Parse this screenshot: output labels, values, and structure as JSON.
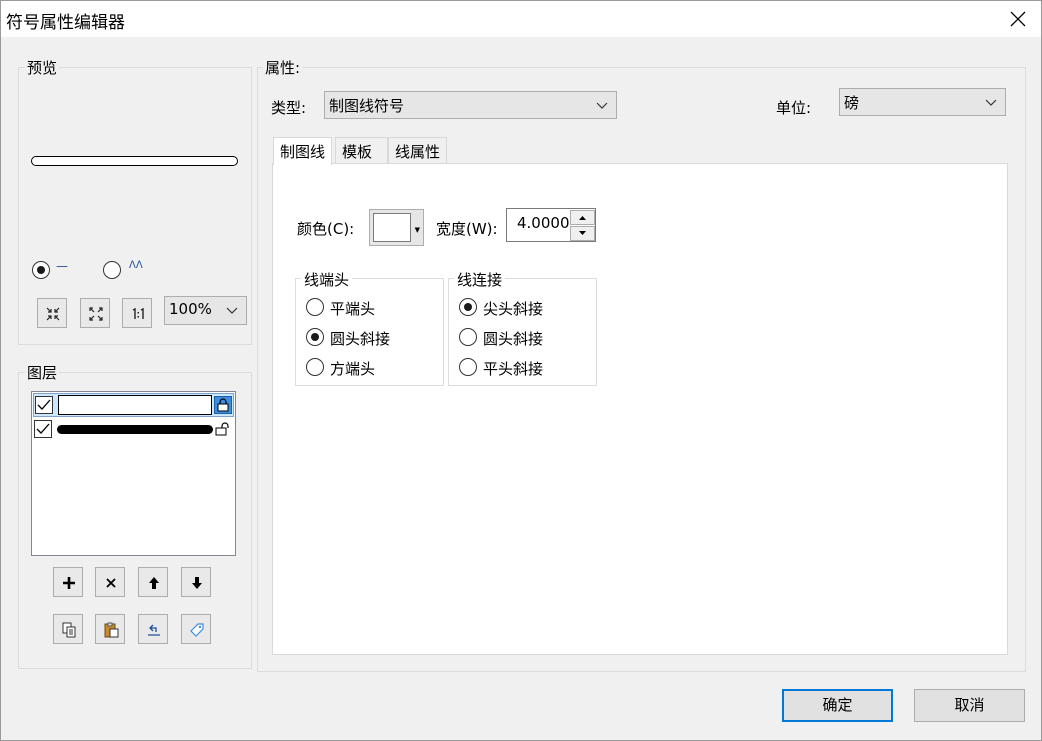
{
  "window": {
    "title": "符号属性编辑器"
  },
  "preview": {
    "label": "预览",
    "radio_options": [
      {
        "glyph": "—",
        "selected": true
      },
      {
        "glyph": "ᐱᐱ",
        "selected": false
      }
    ],
    "tools": [
      "zoom-in-icon",
      "zoom-out-icon",
      "actual-size-icon"
    ],
    "zoom": "100%"
  },
  "layers": {
    "label": "图层",
    "items": [
      {
        "checked": true,
        "locked": true,
        "selected": true,
        "style": "white-line"
      },
      {
        "checked": true,
        "locked": false,
        "selected": false,
        "style": "black-line"
      }
    ],
    "actions": [
      "add-icon",
      "delete-icon",
      "move-up-icon",
      "move-down-icon"
    ],
    "actions2": [
      "copy-icon",
      "paste-icon",
      "reset-icon",
      "tag-icon"
    ]
  },
  "properties": {
    "label": "属性:",
    "type_label": "类型:",
    "type_value": "制图线符号",
    "unit_label": "单位:",
    "unit_value": "磅",
    "tabs": [
      {
        "label": "制图线",
        "active": true
      },
      {
        "label": "模板",
        "active": false
      },
      {
        "label": "线属性",
        "active": false
      }
    ],
    "color_label": "颜色(C):",
    "color_value": "#ffffff",
    "width_label": "宽度(W):",
    "width_value": "4.0000",
    "caps": {
      "label": "线端头",
      "options": [
        {
          "label": "平端头",
          "selected": false
        },
        {
          "label": "圆头斜接",
          "selected": true
        },
        {
          "label": "方端头",
          "selected": false
        }
      ]
    },
    "joins": {
      "label": "线连接",
      "options": [
        {
          "label": "尖头斜接",
          "selected": true
        },
        {
          "label": "圆头斜接",
          "selected": false
        },
        {
          "label": "平头斜接",
          "selected": false
        }
      ]
    }
  },
  "footer": {
    "ok": "确定",
    "cancel": "取消"
  },
  "colors": {
    "accent": "#0078d7",
    "selection": "#cce8ff"
  }
}
